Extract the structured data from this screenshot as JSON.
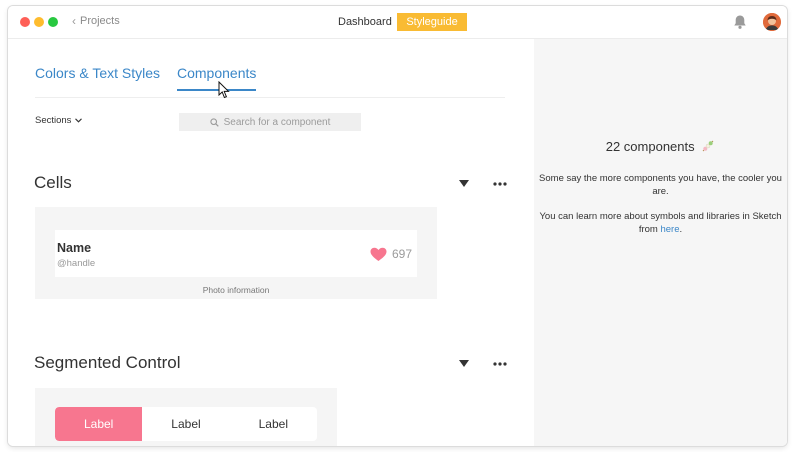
{
  "titlebar": {
    "back_label": "Projects",
    "nav": {
      "dashboard": "Dashboard",
      "styleguide": "Styleguide"
    },
    "styleguide_color": "#f9bb33"
  },
  "tabs": {
    "colors": "Colors & Text Styles",
    "components": "Components",
    "accent": "#3b87c8"
  },
  "toolbar": {
    "sections_label": "Sections",
    "search_placeholder": "Search for a component"
  },
  "sections": {
    "cells": {
      "title": "Cells",
      "cell": {
        "name": "Name",
        "handle": "@handle",
        "likes": "697"
      },
      "caption": "Photo information"
    },
    "segmented": {
      "title": "Segmented Control",
      "items": [
        "Label",
        "Label",
        "Label"
      ],
      "active_color": "#f7768f"
    }
  },
  "right_panel": {
    "count_text": "22 components",
    "line1": "Some say the more components you have, the cooler you are.",
    "line2_pre": "You can learn more about symbols and libraries in Sketch from",
    "link": "here",
    "line2_post": "."
  }
}
